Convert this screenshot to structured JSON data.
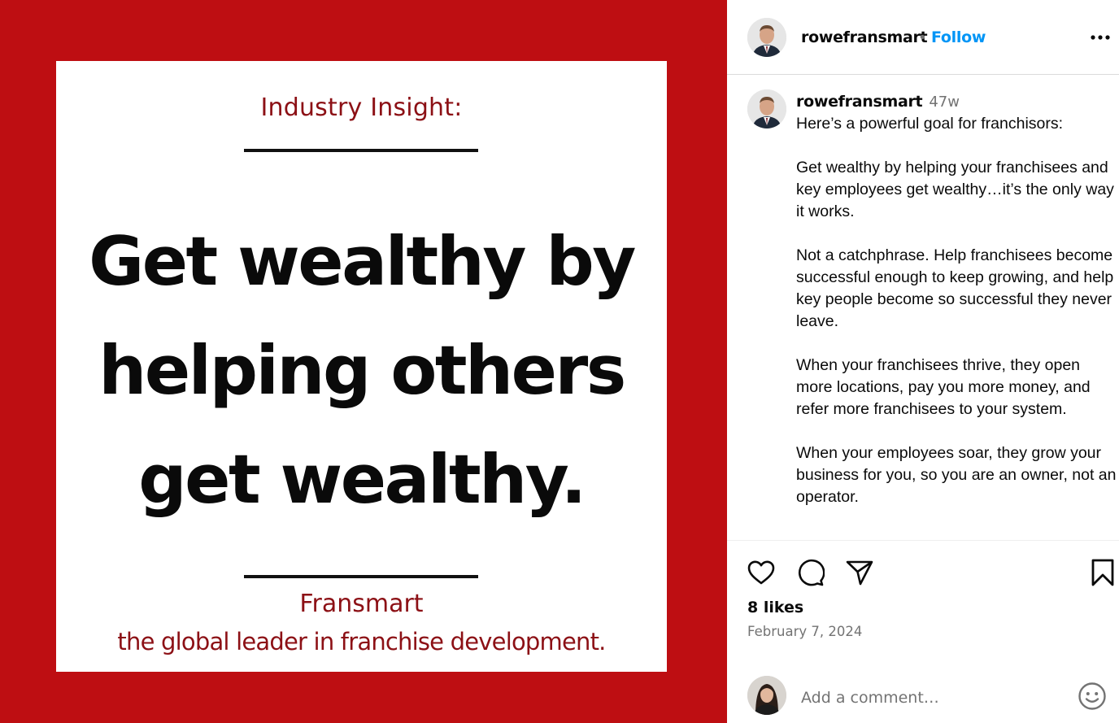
{
  "post_image": {
    "kicker": "Industry Insight:",
    "headline_lines": [
      "Get wealthy by",
      "helping others",
      "get wealthy."
    ],
    "brand": "Fransmart",
    "tagline": "the global leader in franchise development."
  },
  "header": {
    "username": "rowefransmart",
    "separator": "•",
    "follow_label": "Follow"
  },
  "caption": {
    "username": "rowefransmart",
    "time_ago": "47w",
    "first_line": "Here’s a powerful goal for franchisors:",
    "paragraphs": [
      "Get wealthy by helping your franchisees and key employees get wealthy…it’s the only way it works.",
      "Not a catchphrase. Help franchisees become successful enough to keep growing, and help key people become so successful they never leave.",
      "When your franchisees thrive, they open more locations, pay you more money, and refer more franchisees to your system.",
      "When your employees soar, they grow your business for you, so you are an owner, not an operator."
    ]
  },
  "engagement": {
    "likes": "8 likes",
    "date": "February 7, 2024"
  },
  "comment_box": {
    "placeholder": "Add a comment…"
  },
  "icons": {
    "more": "more-options-icon",
    "like": "heart-icon",
    "comment": "comment-icon",
    "share": "share-icon",
    "save": "bookmark-icon",
    "emoji": "emoji-icon"
  },
  "colors": {
    "image_background": "#be0e12",
    "brand_red": "#8c1015",
    "follow_blue": "#0095f6",
    "muted_text": "#737373"
  }
}
